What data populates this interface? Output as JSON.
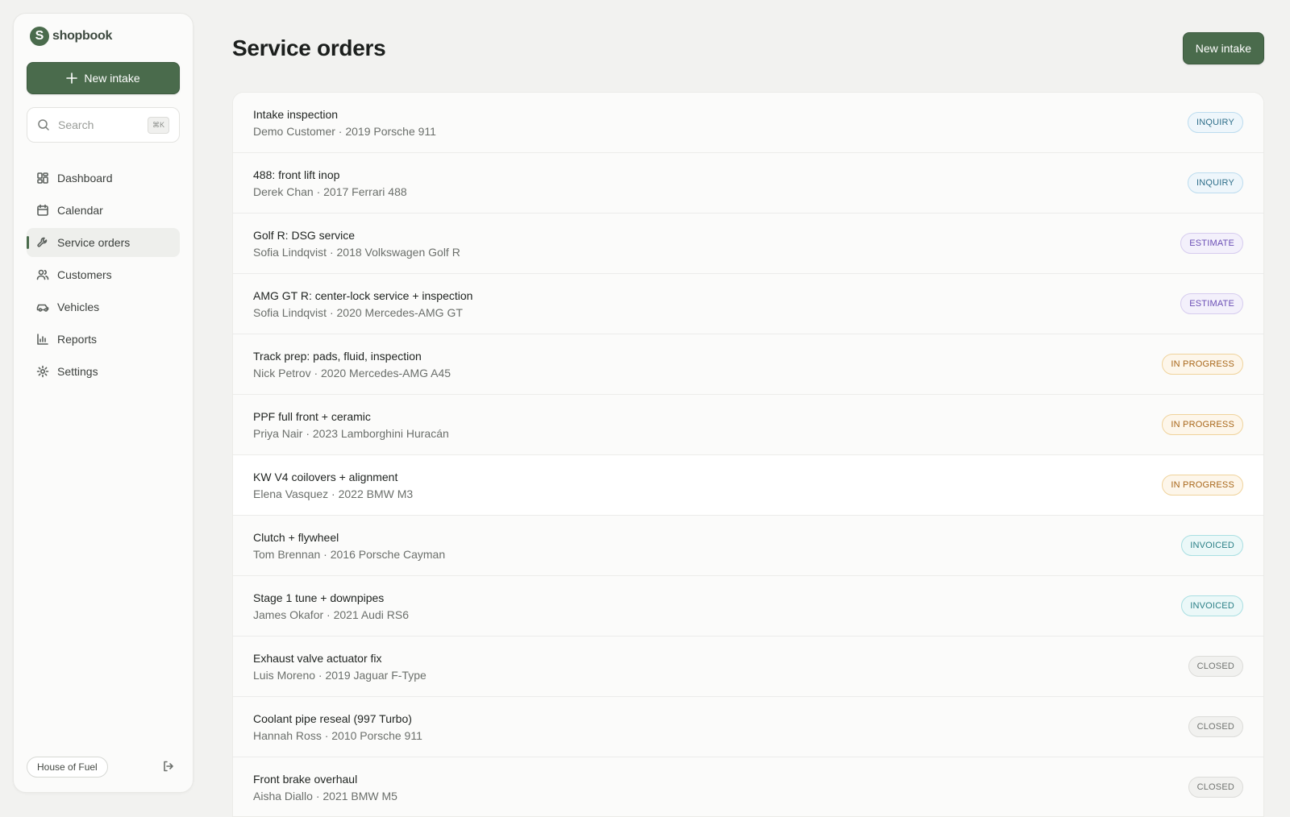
{
  "app": {
    "brand": "shopbook",
    "brand_initial": "S"
  },
  "sidebar": {
    "new_intake_label": "New intake",
    "search": {
      "placeholder": "Search",
      "shortcut": "⌘K"
    },
    "items": [
      {
        "label": "Dashboard",
        "icon": "dashboard-icon"
      },
      {
        "label": "Calendar",
        "icon": "calendar-icon"
      },
      {
        "label": "Service orders",
        "icon": "wrench-icon",
        "active": true
      },
      {
        "label": "Customers",
        "icon": "users-icon"
      },
      {
        "label": "Vehicles",
        "icon": "car-icon"
      },
      {
        "label": "Reports",
        "icon": "bar-chart-icon"
      },
      {
        "label": "Settings",
        "icon": "gear-icon"
      }
    ],
    "shop_name": "House of Fuel"
  },
  "header": {
    "title": "Service orders",
    "new_intake_label": "New intake"
  },
  "orders": [
    {
      "title": "Intake inspection",
      "subtitle": "Demo Customer · 2019 Porsche 911",
      "status": "INQUIRY",
      "status_kind": "inquiry"
    },
    {
      "title": "488: front lift inop",
      "subtitle": "Derek Chan · 2017 Ferrari 488",
      "status": "INQUIRY",
      "status_kind": "inquiry"
    },
    {
      "title": "Golf R: DSG service",
      "subtitle": "Sofia Lindqvist · 2018 Volkswagen Golf R",
      "status": "ESTIMATE",
      "status_kind": "estimate"
    },
    {
      "title": "AMG GT R: center-lock service + inspection",
      "subtitle": "Sofia Lindqvist · 2020 Mercedes-AMG GT",
      "status": "ESTIMATE",
      "status_kind": "estimate"
    },
    {
      "title": "Track prep: pads, fluid, inspection",
      "subtitle": "Nick Petrov · 2020 Mercedes-AMG A45",
      "status": "IN PROGRESS",
      "status_kind": "progress"
    },
    {
      "title": "PPF full front + ceramic",
      "subtitle": "Priya Nair · 2023 Lamborghini Huracán",
      "status": "IN PROGRESS",
      "status_kind": "progress"
    },
    {
      "title": "KW V4 coilovers + alignment",
      "subtitle": "Elena Vasquez · 2022 BMW M3",
      "status": "IN PROGRESS",
      "status_kind": "progress"
    },
    {
      "title": "Clutch + flywheel",
      "subtitle": "Tom Brennan · 2016 Porsche Cayman",
      "status": "INVOICED",
      "status_kind": "invoiced"
    },
    {
      "title": "Stage 1 tune + downpipes",
      "subtitle": "James Okafor · 2021 Audi RS6",
      "status": "INVOICED",
      "status_kind": "invoiced"
    },
    {
      "title": "Exhaust valve actuator fix",
      "subtitle": "Luis Moreno · 2019 Jaguar F-Type",
      "status": "CLOSED",
      "status_kind": "closed"
    },
    {
      "title": "Coolant pipe reseal (997 Turbo)",
      "subtitle": "Hannah Ross · 2010 Porsche 911",
      "status": "CLOSED",
      "status_kind": "closed"
    },
    {
      "title": "Front brake overhaul",
      "subtitle": "Aisha Diallo · 2021 BMW M5",
      "status": "CLOSED",
      "status_kind": "closed"
    }
  ],
  "colors": {
    "accent": "#4a6b4c",
    "background": "#f2f2f0",
    "inquiry": "#2f6f8a",
    "estimate": "#6b4fb5",
    "in_progress": "#a8671a",
    "invoiced": "#2a7f86",
    "closed": "#707370"
  }
}
